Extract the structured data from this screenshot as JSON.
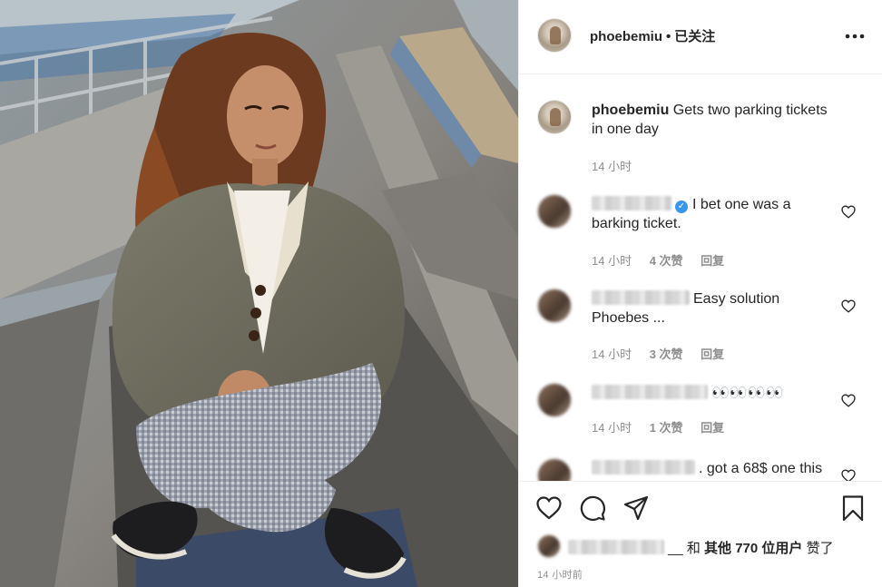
{
  "post": {
    "username": "phoebemiu",
    "separator": "•",
    "follow_status": "已关注",
    "more_icon": "more-horizontal-icon"
  },
  "caption": {
    "username": "phoebemiu",
    "text": "Gets two parking tickets in one day",
    "time": "14 小时"
  },
  "comments": [
    {
      "text": "I bet one was a barking ticket.",
      "time": "14 小时",
      "likes": "4 次赞",
      "reply": "回复",
      "verified": true
    },
    {
      "text": "Easy solution Phoebes ...",
      "time": "14 小时",
      "likes": "3 次赞",
      "reply": "回复",
      "verified": false
    },
    {
      "text": "👀👀👀👀",
      "time": "14 小时",
      "likes": "1 次赞",
      "reply": "回复",
      "verified": false
    },
    {
      "text": ". got a 68$ one this",
      "verified": false
    }
  ],
  "likes": {
    "prefix": "__ 和 ",
    "others": "其他 770 位用户",
    "suffix": " 赞了"
  },
  "timestamp": "14 小时前",
  "icons": {
    "like": "heart-icon",
    "comment": "comment-icon",
    "share": "paper-plane-icon",
    "save": "bookmark-icon"
  },
  "colors": {
    "text": "#262626",
    "secondary": "#8e8e8e",
    "verified": "#3897f0",
    "border": "#efefef"
  }
}
